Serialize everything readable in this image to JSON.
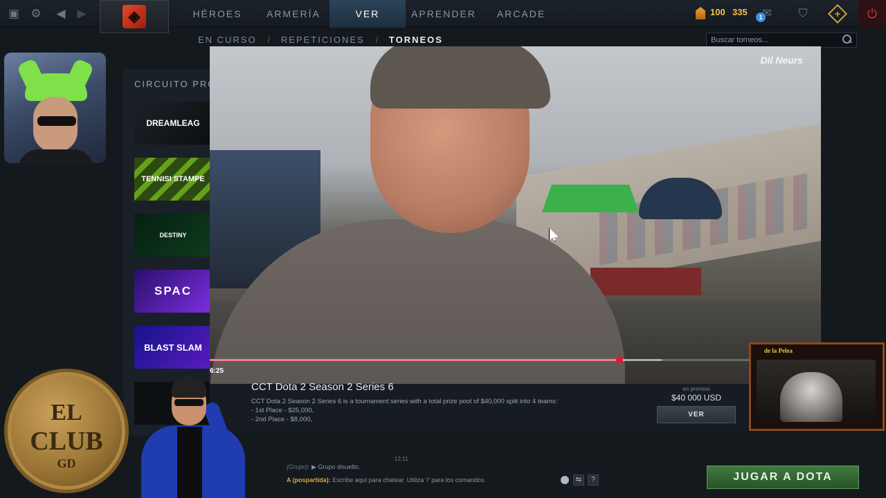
{
  "topnav": {
    "tabs": [
      {
        "label": "HÉROES"
      },
      {
        "label": "ARMERÍA"
      },
      {
        "label": "VER"
      },
      {
        "label": "APRENDER"
      },
      {
        "label": "ARCADE"
      }
    ],
    "active_tab": "VER",
    "shards": "100",
    "gold": "335",
    "notification_count": "1"
  },
  "subnav": {
    "items": [
      "EN CURSO",
      "REPETICIONES",
      "TORNEOS"
    ],
    "active": "TORNEOS"
  },
  "search": {
    "placeholder": "Buscar torneos..."
  },
  "sidebar": {
    "section_title": "CIRCUITO PROFE",
    "tiles": [
      {
        "label": "DREAMLEAG"
      },
      {
        "label": "TENNISI STAMPE"
      },
      {
        "label": "DESTINY"
      },
      {
        "label": "SPAC"
      },
      {
        "label": "BLAST SLAM"
      }
    ]
  },
  "video": {
    "watermark": "Dil Neurs",
    "time": "6:25",
    "progress": 0.67,
    "buffered": 0.74
  },
  "tournament": {
    "title": "CCT Dota 2 Season 2 Series 6",
    "description": "CCT Dota 2 Season 2 Series 6 is a tournament series with a total prize pool of $40,000 split into 4 teams:",
    "places": [
      "- 1st Place - $25,000,",
      "- 2nd Place - $8,000,"
    ],
    "prize_label": "en premios",
    "prize_value": "$40 000 USD",
    "view_button": "VER"
  },
  "overlay": {
    "fight_label": "de la Pelea",
    "coin_line1": "EL",
    "coin_line2": "CLUB",
    "coin_line3": "GD"
  },
  "chat": {
    "timestamp": "12:11",
    "group_prefix": "(Grupo):",
    "group_message": "▶ Grupo disuelto.",
    "input_target": "A (pospartida):",
    "input_placeholder": "Escribe aquí para chatear. Utiliza '/' para los comandos.",
    "help_label": "?"
  },
  "play_button": "JUGAR A DOTA"
}
